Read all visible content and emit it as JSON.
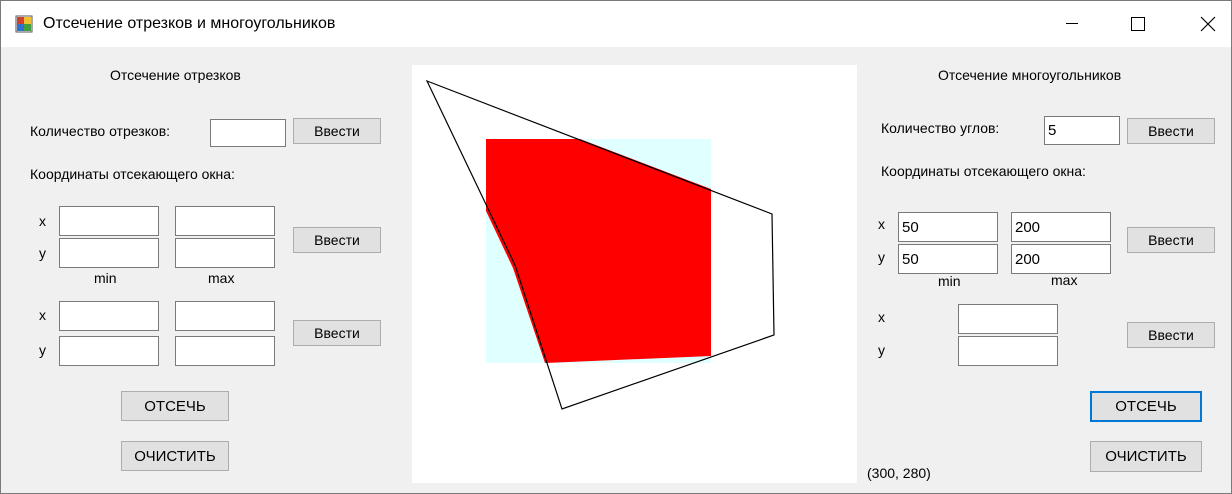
{
  "window": {
    "title": "Отсечение отрезков и многоугольников",
    "controls": {
      "minimize": "minimize-icon",
      "maximize": "maximize-icon",
      "close": "close-icon"
    }
  },
  "segments": {
    "heading": "Отсечение отрезков",
    "count_label": "Количество отрезков:",
    "count_value": "",
    "count_button": "Ввести",
    "window_label": "Координаты отсекающего окна:",
    "x_label": "x",
    "y_label": "y",
    "min_label": "min",
    "max_label": "max",
    "window_x_min": "",
    "window_x_max": "",
    "window_y_min": "",
    "window_y_max": "",
    "window_button": "Ввести",
    "point_x_label": "x",
    "point_y_label": "y",
    "p_x1": "",
    "p_x2": "",
    "p_y1": "",
    "p_y2": "",
    "point_button": "Ввести",
    "clip_button": "ОТСЕЧЬ",
    "clear_button": "ОЧИСТИТЬ"
  },
  "polygons": {
    "heading": "Отсечение многоугольников",
    "angles_label": "Количество углов:",
    "angles_value": "5",
    "angles_button": "Ввести",
    "window_label": "Координаты отсекающего окна:",
    "x_label": "x",
    "y_label": "y",
    "min_label": "min",
    "max_label": "max",
    "window_x_min": "50",
    "window_x_max": "200",
    "window_y_min": "50",
    "window_y_max": "200",
    "window_button": "Ввести",
    "point_x_label": "x",
    "point_y_label": "y",
    "point_x": "",
    "point_y": "",
    "point_button": "Ввести",
    "clip_button": "ОТСЕЧЬ",
    "clear_button": "ОЧИСТИТЬ",
    "cursor_coords": "(300, 280)"
  },
  "colors": {
    "clip_window": "#e0ffff",
    "clipped_fill": "#ff0000",
    "polygon_outline": "#000000",
    "focus_border": "#0078d7"
  }
}
